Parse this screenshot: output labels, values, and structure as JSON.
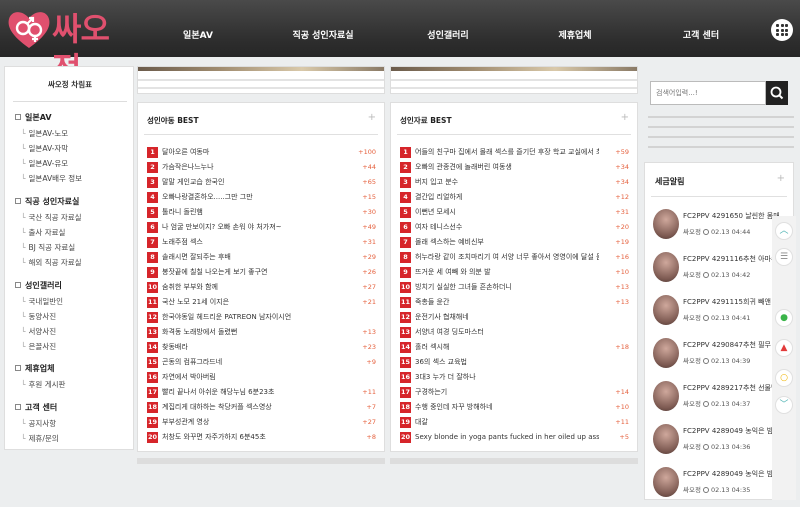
{
  "header": {
    "logo_text": "싸오정",
    "nav": [
      "일본AV",
      "직공 성인자료실",
      "성인갤러리",
      "제휴업체",
      "고객 센터"
    ]
  },
  "sidebar": {
    "title": "싸오정 차림표",
    "groups": [
      {
        "label": "일본AV",
        "items": [
          "일본AV-노모",
          "일본AV-자막",
          "일본AV-유모",
          "일본AV배우 정보"
        ]
      },
      {
        "label": "직공 성인자료실",
        "items": [
          "국산 직공 자료실",
          "출사 자료실",
          "BJ 직공 자료실",
          "해외 직공 자료실"
        ]
      },
      {
        "label": "성인갤러리",
        "items": [
          "국내일반인",
          "동양사진",
          "서양사진",
          "은꼴사진"
        ]
      },
      {
        "label": "제휴업체",
        "items": [
          "후원 게시판"
        ]
      },
      {
        "label": "고객 센터",
        "items": [
          "공지사항",
          "제휴/문의"
        ]
      }
    ]
  },
  "best_left": {
    "title": "성인야동 BEST",
    "plus": "+",
    "rows": [
      {
        "n": "1",
        "t": "달아오른 여동마",
        "c": "+100"
      },
      {
        "n": "2",
        "t": "가슴작은나느누나",
        "c": "+44"
      },
      {
        "n": "3",
        "t": "말말 게인교습 한국인",
        "c": "+65"
      },
      {
        "n": "4",
        "t": "오빠나랑결혼하오.....그만 그만",
        "c": "+15"
      },
      {
        "n": "5",
        "t": "톨라니 돌린햄",
        "c": "+30"
      },
      {
        "n": "6",
        "t": "나 엄굴 만보이지? 오빠 손워 야 처가져~",
        "c": "+49"
      },
      {
        "n": "7",
        "t": "노래주점 섹스",
        "c": "+31"
      },
      {
        "n": "8",
        "t": "솔래시면 잘되주는 후배",
        "c": "+29"
      },
      {
        "n": "9",
        "t": "봉잣끝에 칠칠 나오는게 보기 좋구연",
        "c": "+26"
      },
      {
        "n": "10",
        "t": "숨취한 부부와 함께",
        "c": "+27"
      },
      {
        "n": "11",
        "t": "국산 노모 21세 이지은",
        "c": "+21"
      },
      {
        "n": "12",
        "t": "한국야동일 헤드리운 PATREON 남자이시언",
        "c": ""
      },
      {
        "n": "13",
        "t": "화격동 노래방에서 돌렸뻔",
        "c": "+13"
      },
      {
        "n": "14",
        "t": "찾동배라",
        "c": "+23"
      },
      {
        "n": "15",
        "t": "곤동의 컴퓨그라드네",
        "c": "+9"
      },
      {
        "n": "16",
        "t": "자연에서 박아버림",
        "c": ""
      },
      {
        "n": "17",
        "t": "빨리 끝나서 아쉬운 해당누님 6분23초",
        "c": "+11"
      },
      {
        "n": "18",
        "t": "계집리게 대하하는 착당커플 섹스영상",
        "c": "+7"
      },
      {
        "n": "19",
        "t": "부부성관계 영상",
        "c": "+27"
      },
      {
        "n": "20",
        "t": "처창도 와꾸면 자주가하지 6분45초",
        "c": "+8"
      }
    ]
  },
  "best_right": {
    "title": "성인자료 BEST",
    "plus": "+",
    "rows": [
      {
        "n": "1",
        "t": "어들의 친구마 집에서 몰래 섹스를 즐기던 후장 학교 교실에서 최선 선생님...",
        "c": "+59"
      },
      {
        "n": "2",
        "t": "오빠의 관종견에 놀래버린 여동생",
        "c": "+34"
      },
      {
        "n": "3",
        "t": "버지 입고 분수",
        "c": "+34"
      },
      {
        "n": "4",
        "t": "결간입 리얼하게",
        "c": "+12"
      },
      {
        "n": "5",
        "t": "이뻔년 모세시",
        "c": "+31"
      },
      {
        "n": "6",
        "t": "여자 테니스선수",
        "c": "+20"
      },
      {
        "n": "7",
        "t": "몰래 섹스하는 예비신부",
        "c": "+19"
      },
      {
        "n": "8",
        "t": "허누라랑 같이 조치마리기 여 서양 너무 좋아서 영영이에 달설 듣은 하...",
        "c": "+16"
      },
      {
        "n": "9",
        "t": "뜨거운 세 여빼 와 의분 발",
        "c": "+10"
      },
      {
        "n": "10",
        "t": "빙치기 실실한 그녀들 흔손하더니",
        "c": "+13"
      },
      {
        "n": "11",
        "t": "죽총들 윤간",
        "c": "+13"
      },
      {
        "n": "12",
        "t": "운전기사 협채해네",
        "c": ""
      },
      {
        "n": "13",
        "t": "서양녀 여경 딩도마스터",
        "c": ""
      },
      {
        "n": "14",
        "t": "홀러 섹시해",
        "c": "+18"
      },
      {
        "n": "15",
        "t": "36의 섹스 교육법",
        "c": ""
      },
      {
        "n": "16",
        "t": "3대3 누가 더 잘하나",
        "c": ""
      },
      {
        "n": "17",
        "t": "구경하는기",
        "c": "+14"
      },
      {
        "n": "18",
        "t": "수행 중인데 자꾸 방해하네",
        "c": "+10"
      },
      {
        "n": "19",
        "t": "대갈",
        "c": "+11"
      },
      {
        "n": "20",
        "t": "Sexy blonde in yoga pants fucked in her oiled up ass",
        "c": "+5"
      }
    ]
  },
  "search": {
    "placeholder": "검색어입력...!"
  },
  "tax_alert": {
    "title": "세금알림",
    "plus": "+",
    "items": [
      {
        "title": "FC2PPV 4291650 날씬한 몸매 ...",
        "author": "싸오정",
        "time": "02.13 04:44"
      },
      {
        "title": "FC2PPV 4291116추천 아마수준...",
        "author": "싸오정",
        "time": "02.13 04:42"
      },
      {
        "title": "FC2PPV 4291115희귀 빼앤 가...",
        "author": "싸오정",
        "time": "02.13 04:41"
      },
      {
        "title": "FC2PPV 4290847추천 필무 번...",
        "author": "싸오정",
        "time": "02.13 04:39"
      },
      {
        "title": "FC2PPV 4289217추천 선물맹기...",
        "author": "싸오정",
        "time": "02.13 04:37"
      },
      {
        "title": "FC2PPV 4289049 농익은 밤쀙...",
        "author": "싸오정",
        "time": "02.13 04:36"
      },
      {
        "title": "FC2PPV 4289049 농익은 밤쀙...",
        "author": "싸오정",
        "time": "02.13 04:35"
      }
    ]
  },
  "colors": {
    "accent": "#d6252a",
    "count": "#e5603d",
    "logo": "#e0506e",
    "header": "#333333"
  },
  "fab_icons": [
    "chevron-up-icon",
    "list-icon",
    "chat-icon",
    "bell-icon",
    "search-icon",
    "chevron-down-icon"
  ]
}
